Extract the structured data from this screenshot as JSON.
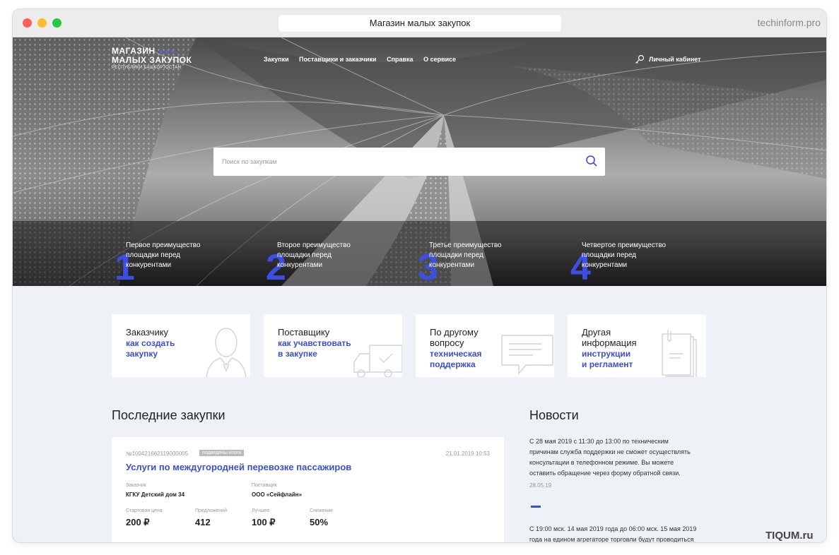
{
  "browser": {
    "tab_title": "Магазин малых закупок",
    "domain": "techinform.pro"
  },
  "header": {
    "logo": {
      "line1": "МАГАЗИН",
      "line2": "МАЛЫХ ЗАКУПОК",
      "line3": "РЕСПУБЛИКИ БАШКОРТОСТАН"
    },
    "nav": [
      "Закупки",
      "Поставщики и заказчики",
      "Справка",
      "О сервисе"
    ],
    "cabinet_label": "Личный кабинет"
  },
  "search": {
    "placeholder": "Поиск по закупкам",
    "value": ""
  },
  "advantages": [
    {
      "number": "1",
      "text_lines": [
        "Первое преимущество",
        "площадки перед",
        "конкурентами"
      ]
    },
    {
      "number": "2",
      "text_lines": [
        "Второе преимущество",
        "площадки перед",
        "конкурентами"
      ]
    },
    {
      "number": "3",
      "text_lines": [
        "Третье преимущество",
        "площадки перед",
        "конкурентами"
      ]
    },
    {
      "number": "4",
      "text_lines": [
        "Четвертое преимущество",
        "площадки перед",
        "конкурентами"
      ]
    }
  ],
  "cards": [
    {
      "title_lines": [
        "Заказчику"
      ],
      "link_lines": [
        "как создать",
        "закупку"
      ],
      "icon": "person-icon"
    },
    {
      "title_lines": [
        "Поставщику"
      ],
      "link_lines": [
        "как учавствовать",
        "в закупке"
      ],
      "icon": "truck-icon"
    },
    {
      "title_lines": [
        "По другому",
        "вопросу"
      ],
      "link_lines": [
        "техническая",
        "поддержка"
      ],
      "icon": "chat-icon"
    },
    {
      "title_lines": [
        "Другая",
        "информация"
      ],
      "link_lines": [
        "инструкции",
        "и регламент"
      ],
      "icon": "documents-icon"
    }
  ],
  "latest": {
    "title": "Последние закупки",
    "item": {
      "number": "№100421662119000005",
      "status": "подведены итоги",
      "date": "21.01.2019 10:53",
      "title": "Услуги по междугородней перевозке пассажиров",
      "customer_label": "Заказчик",
      "customer": "КГКУ Детский дом 34",
      "supplier_label": "Поставщик",
      "supplier": "ООО «Сейфлайн»",
      "start_price_label": "Стартовая цена",
      "start_price": "200 ₽",
      "offers_label": "Предложений",
      "offers": "412",
      "best_label": "Лучшее",
      "best": "100 ₽",
      "reduction_label": "Снижение",
      "reduction": "50%"
    }
  },
  "news": {
    "title": "Новости",
    "items": [
      {
        "lines": [
          "С 28 мая 2019 с 11:30 до 13:00 по техническим",
          "причинам служба поддержки не сможет осуществлять",
          "консультации в телефонном режиме. Вы можете",
          "оставить обращение через форму обратной связи."
        ],
        "date": "28.05.19"
      },
      {
        "lines": [
          "С 19:00 мск. 14 мая 2019 года до 06:00 мск. 15 мая 2019",
          "года на едином агрегаторе торговли будут проводиться"
        ],
        "date": ""
      }
    ]
  },
  "watermark": "TIQUM.ru"
}
